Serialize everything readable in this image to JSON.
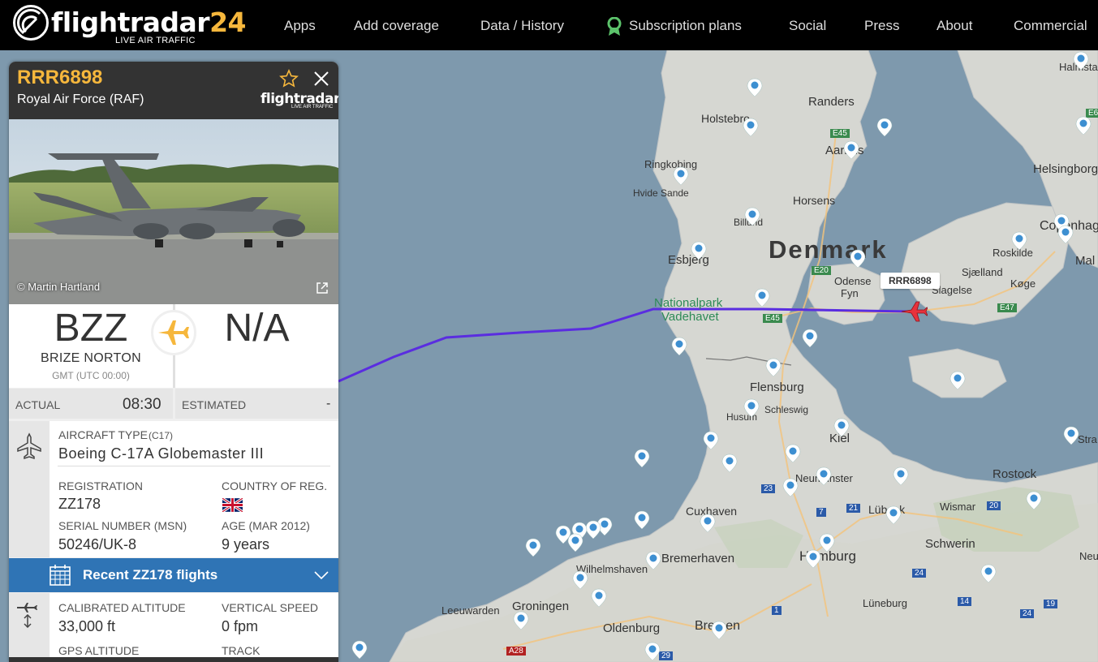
{
  "nav": {
    "logo_brand": "flightradar",
    "logo_number": "24",
    "logo_tagline": "LIVE AIR TRAFFIC",
    "items": [
      "Apps",
      "Add coverage",
      "Data / History",
      "Subscription plans",
      "Social",
      "Press",
      "About",
      "Commercial"
    ]
  },
  "map": {
    "labels": {
      "denmark": "Denmark",
      "randers": "Randers",
      "holstebro": "Holstebro",
      "aarhus": "Aarhus",
      "ringkobing": "Ringkobing",
      "hvide_sande": "Hvide Sande",
      "horsens": "Horsens",
      "billund": "Billund",
      "esbjerg": "Esbjerg",
      "odense": "Odense",
      "fyn": "Fyn",
      "sjaelland": "Sjælland",
      "koge": "Køge",
      "slagelse": "Slagelse",
      "roskilde": "Roskilde",
      "copenhagen": "Copenhagen",
      "helsingborg": "Helsingborg",
      "halmstad": "Halmstad",
      "nationalpark": "Nationalpark",
      "vadehavet": "Vadehavet",
      "flensburg": "Flensburg",
      "schleswig": "Schleswig",
      "husum": "Husum",
      "kiel": "Kiel",
      "neumunster": "Neumunster",
      "rostock": "Rostock",
      "wismar": "Wismar",
      "lubeck": "Lübeck",
      "cuxhaven": "Cuxhaven",
      "schwerin": "Schwerin",
      "hamburg": "Hamburg",
      "bremerhaven": "Bremerhaven",
      "wilhelmshaven": "Wilhelmshaven",
      "groningen": "Groningen",
      "leeuwarden": "Leeuwarden",
      "oldenburg": "Oldenburg",
      "bremen": "Bremen",
      "luneburg": "Lüneburg",
      "strals": "Stra",
      "neu": "Neu",
      "malmo": "Mal"
    },
    "road_labels": [
      "E45",
      "E20",
      "E45",
      "E47",
      "23",
      "7",
      "21",
      "20",
      "24",
      "14",
      "19",
      "24",
      "1",
      "29",
      "A28",
      "E6"
    ],
    "flight_callsign_label": "RRR6898"
  },
  "panel": {
    "callsign": "RRR6898",
    "airline": "Royal Air Force (RAF)",
    "logo_brand": "flightradar",
    "logo_number": "24",
    "logo_tagline": "LIVE AIR TRAFFIC",
    "photo_credit": "© Martin Hartland",
    "origin_iata": "BZZ",
    "origin_city": "BRIZE NORTON",
    "origin_tz": "GMT (UTC 00:00)",
    "dest_iata": "N/A",
    "actual_label": "ACTUAL",
    "actual_time": "08:30",
    "estimated_label": "ESTIMATED",
    "estimated_time": "-",
    "aircraft_type_label": "AIRCRAFT TYPE",
    "aircraft_type_code": "(C17)",
    "aircraft_type": "Boeing C-17A Globemaster III",
    "registration_label": "REGISTRATION",
    "registration": "ZZ178",
    "country_label": "COUNTRY OF REG.",
    "serial_label": "SERIAL NUMBER (MSN)",
    "serial": "50246/UK-8",
    "age_label": "AGE (MAR 2012)",
    "age": "9 years",
    "recent_flights": "Recent ZZ178 flights",
    "calibrated_alt_label": "CALIBRATED ALTITUDE",
    "calibrated_alt": "33,000 ft",
    "vertical_speed_label": "VERTICAL SPEED",
    "vertical_speed": "0 fpm",
    "gps_alt_label": "GPS ALTITUDE",
    "track_label": "TRACK"
  },
  "colors": {
    "accent": "#f6b73c",
    "recent_bar": "#2f74b5",
    "track": "#5a2de0",
    "aircraft": "#e8323c"
  }
}
